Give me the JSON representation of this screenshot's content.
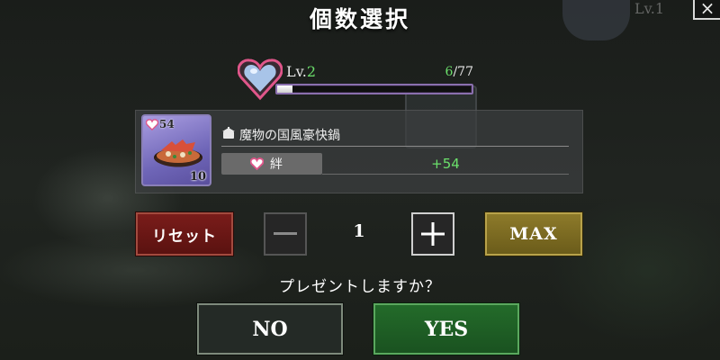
{
  "dialog": {
    "title": "個数選択",
    "close_label": "×"
  },
  "background": {
    "level_hint": "Lv.1"
  },
  "level": {
    "prefix": "Lv.",
    "value": "2",
    "current": "6",
    "max": "/77",
    "progress_fraction": 0.08
  },
  "item": {
    "name": "魔物の国風豪快鍋",
    "points": "54",
    "owned_count": "10",
    "bond_label": "絆",
    "bond_value": "+54",
    "icon": "hot-pot-food-icon"
  },
  "controls": {
    "reset_label": "リセット",
    "minus_icon": "minus-icon",
    "quantity": "1",
    "plus_icon": "plus-icon",
    "max_label": "MAX"
  },
  "confirm": {
    "question": "プレゼントしますか？",
    "no_label": "NO",
    "yes_label": "YES"
  },
  "colors": {
    "accent_green": "#6be06b",
    "reset_red": "#7a1c1a",
    "max_gold": "#8d7a2a",
    "yes_green": "#236b2a",
    "heart_pink": "#e0568a"
  }
}
